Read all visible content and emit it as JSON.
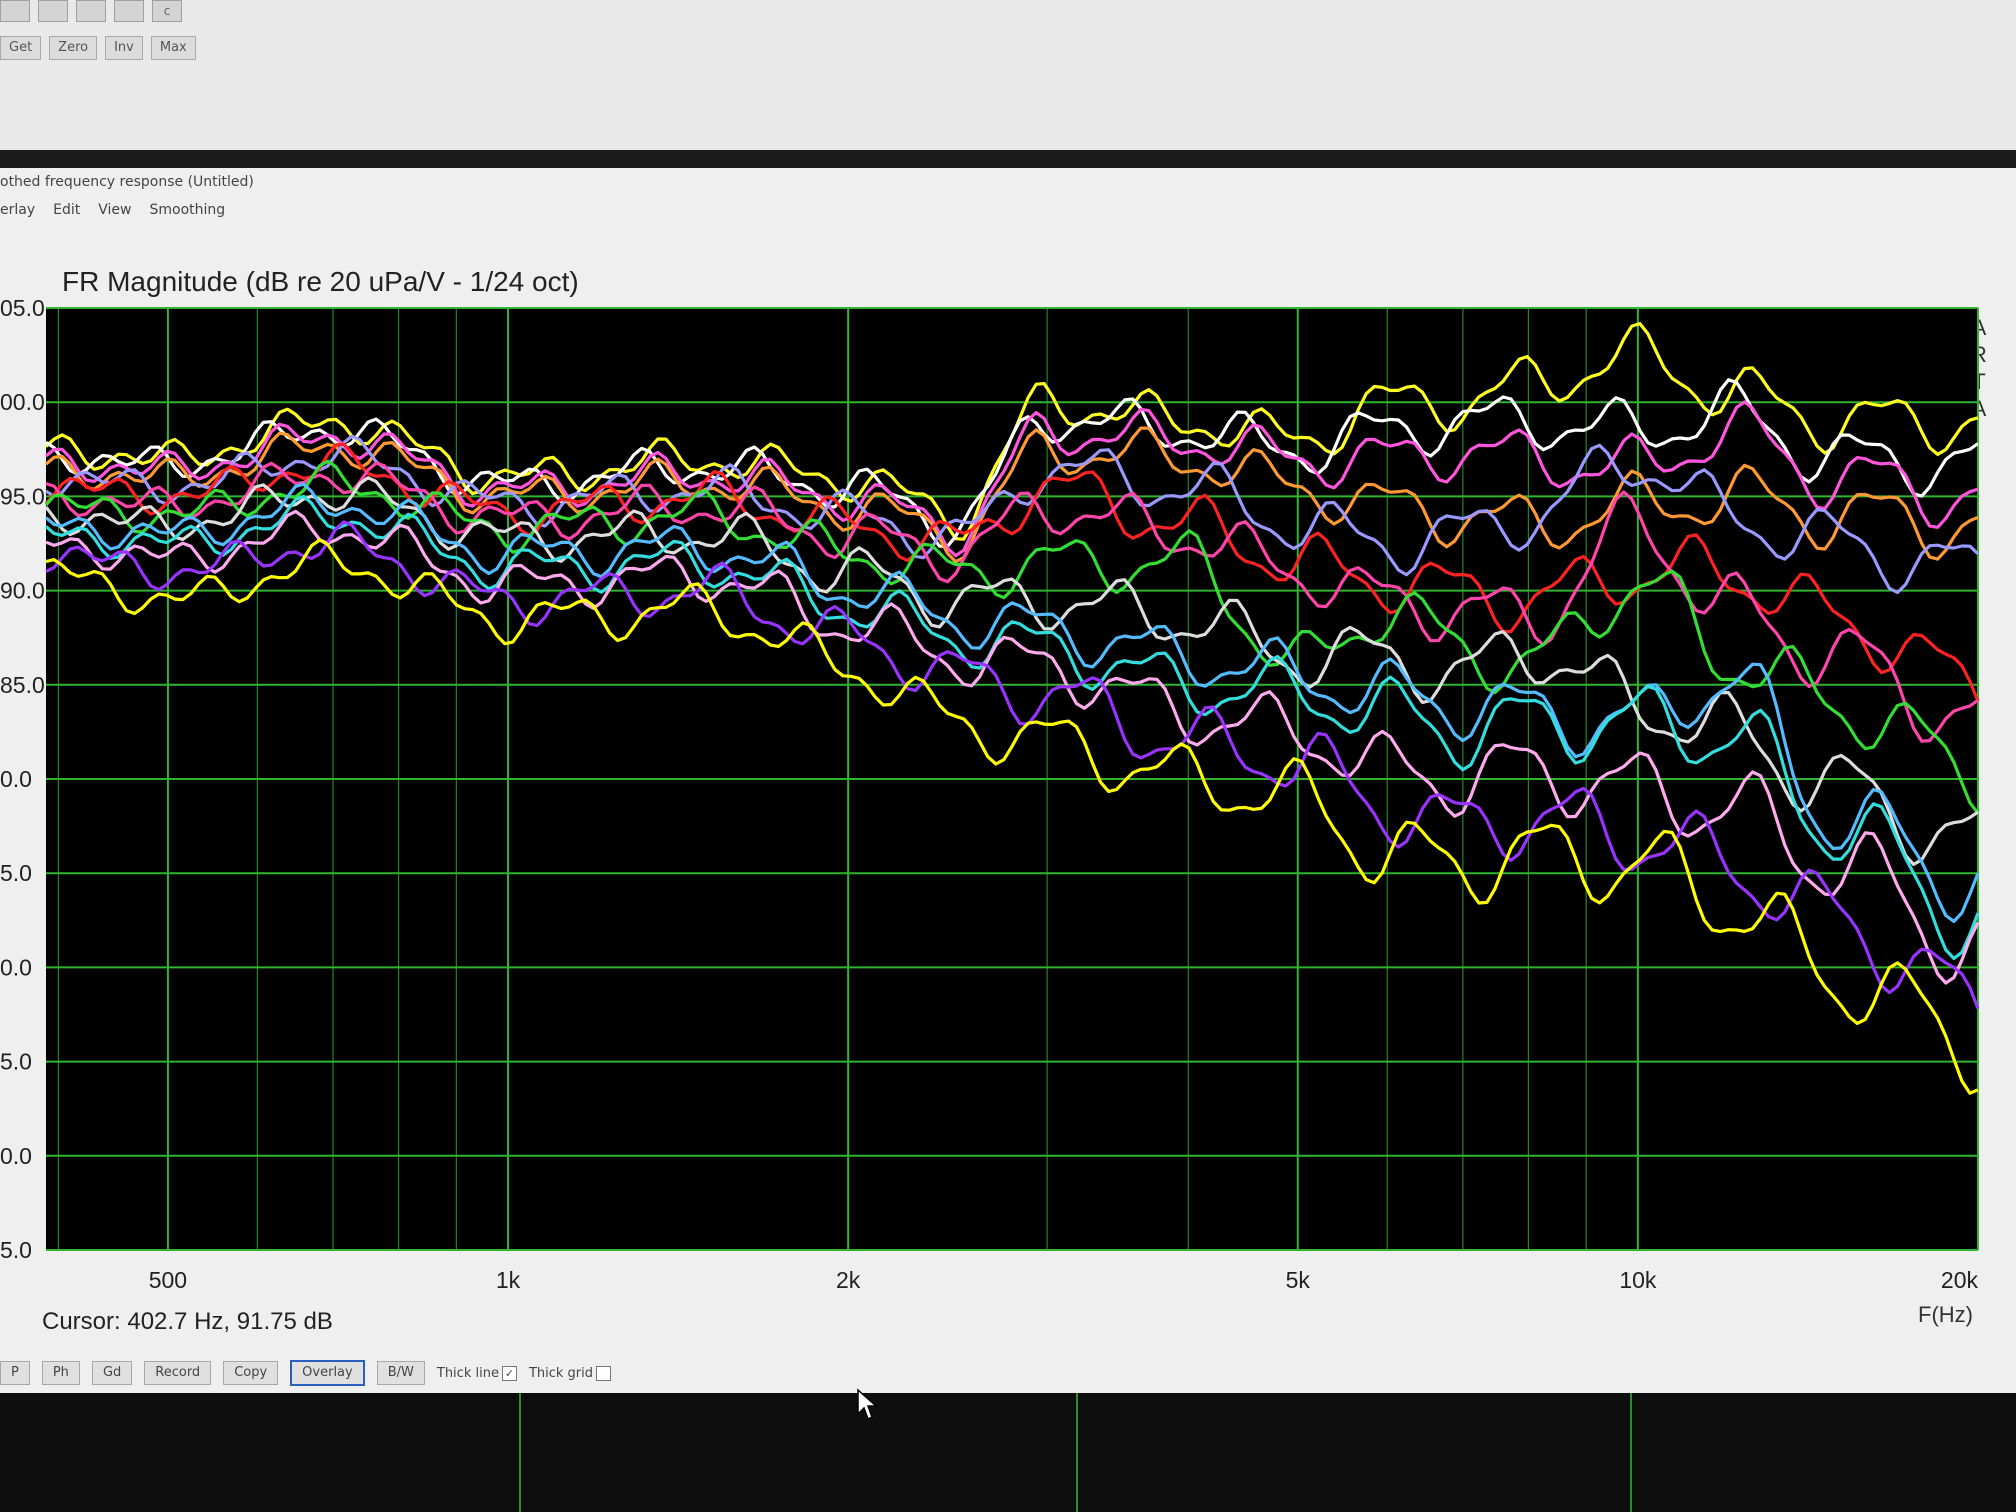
{
  "toolbar": {
    "icons": [
      "spectrum-icon",
      "window-icon",
      "overlay-icon",
      "graph-icon",
      "c-icon"
    ],
    "icon_glyphs": [
      "",
      "",
      "",
      "",
      "c"
    ],
    "buttons": [
      "Get",
      "Zero",
      "Inv",
      "Max"
    ]
  },
  "window": {
    "title": "othed frequency response (Untitled)",
    "menu": [
      "erlay",
      "Edit",
      "View",
      "Smoothing"
    ]
  },
  "footer": {
    "cursor": "Cursor: 402.7 Hz, 91.75 dB",
    "funit": "F(Hz)",
    "buttons": [
      "P",
      "Ph",
      "Gd",
      "Record",
      "Copy",
      "Overlay",
      "B/W"
    ],
    "active_button": "Overlay",
    "thick_line": "Thick line",
    "thick_line_checked": true,
    "thick_grid": "Thick grid",
    "thick_grid_checked": false,
    "brand": "ARTA"
  },
  "chart_data": {
    "type": "line",
    "title": "FR Magnitude (dB re 20 uPa/V - 1/24 oct)",
    "xlabel": "F(Hz)",
    "ylabel": "",
    "xscale": "log",
    "xlim": [
      390,
      20000
    ],
    "ylim": [
      55,
      105
    ],
    "yticks": [
      105,
      100,
      95,
      90,
      85,
      80,
      75,
      70,
      65,
      60,
      55
    ],
    "ytick_labels": [
      "05.0",
      "00.0",
      "95.0",
      "90.0",
      "85.0",
      "0.0",
      "5.0",
      "0.0",
      "5.0",
      "0.0",
      "5.0"
    ],
    "xticks": [
      500,
      1000,
      2000,
      5000,
      10000,
      20000
    ],
    "xtick_labels": [
      "500",
      "1k",
      "2k",
      "5k",
      "10k",
      "20k"
    ],
    "minor_grid_x": [
      400,
      600,
      700,
      800,
      900,
      3000,
      4000,
      6000,
      7000,
      8000,
      9000
    ],
    "grid": true,
    "background": "#000000",
    "grid_color": "#2fb52f",
    "x": [
      390,
      500,
      700,
      1000,
      1500,
      2000,
      2500,
      3000,
      4000,
      5000,
      6000,
      7000,
      8000,
      10000,
      12000,
      15000,
      20000
    ],
    "series": [
      {
        "color": "#ffff22",
        "values": [
          97.5,
          97,
          99,
          96,
          97,
          96,
          94,
          100,
          99,
          98,
          100,
          100,
          101,
          102.5,
          100.5,
          99,
          99
        ]
      },
      {
        "color": "#ffffff",
        "values": [
          97.2,
          96.7,
          98.6,
          95.6,
          96.6,
          95.5,
          93.6,
          99.2,
          98.5,
          97.5,
          98.5,
          99,
          99,
          98.5,
          99.5,
          97,
          96.8
        ]
      },
      {
        "color": "#ff55dd",
        "values": [
          96.8,
          96.4,
          98.2,
          95.3,
          96.2,
          95,
          93.3,
          98.5,
          98,
          97,
          97,
          97.5,
          97,
          96.5,
          98.5,
          96,
          95
        ]
      },
      {
        "color": "#ff9933",
        "values": [
          96.4,
          96,
          97.7,
          95,
          95.8,
          94.5,
          93,
          97.5,
          97,
          95.5,
          94.5,
          94,
          93.5,
          94.5,
          95,
          94,
          93.5
        ]
      },
      {
        "color": "#9999ff",
        "values": [
          96,
          95.5,
          97.2,
          94.6,
          95.4,
          94,
          92.8,
          96.5,
          95.5,
          93.5,
          92.5,
          93,
          94,
          97,
          94,
          92.5,
          91
        ]
      },
      {
        "color": "#ff2222",
        "values": [
          95.5,
          95,
          96.7,
          94.2,
          95,
          93.5,
          92.5,
          95.5,
          93.5,
          91.5,
          90.5,
          90,
          89.5,
          91,
          91,
          88.5,
          85
        ]
      },
      {
        "color": "#ff44aa",
        "values": [
          95,
          94.5,
          96.2,
          93.8,
          94.5,
          93,
          92,
          94.5,
          93,
          91,
          89.5,
          89,
          88.5,
          93.5,
          89,
          86.5,
          83
        ]
      },
      {
        "color": "#33dd33",
        "values": [
          94.5,
          94,
          95.7,
          93.3,
          94,
          92,
          91,
          91.5,
          91.5,
          86,
          89,
          87,
          86,
          90.5,
          86.5,
          84,
          80.5
        ]
      },
      {
        "color": "#dddddd",
        "values": [
          94,
          93.5,
          95.2,
          92.8,
          93,
          91,
          89.5,
          89.5,
          88.5,
          86.5,
          86.5,
          85.5,
          87,
          84,
          82.5,
          79.5,
          76.5
        ]
      },
      {
        "color": "#55bbff",
        "values": [
          93.5,
          93,
          94.7,
          92,
          92.3,
          90.2,
          88.5,
          88,
          86.5,
          85.5,
          84.5,
          84,
          83.5,
          83,
          85.5,
          78,
          74.5
        ]
      },
      {
        "color": "#33dddd",
        "values": [
          93,
          92.5,
          94,
          91.2,
          91.5,
          89.2,
          87.5,
          87,
          85,
          84.5,
          83.5,
          82.5,
          83,
          83,
          82.5,
          77.5,
          72.5
        ]
      },
      {
        "color": "#ffaaee",
        "values": [
          92.5,
          91.7,
          93.3,
          90.3,
          90.8,
          88.3,
          86.5,
          86,
          83.5,
          82.5,
          80.5,
          80,
          80.5,
          79.5,
          78.5,
          75.5,
          71
        ]
      },
      {
        "color": "#9933ff",
        "values": [
          92,
          91,
          92.5,
          89.5,
          90,
          87.5,
          85.5,
          84.5,
          82,
          81,
          78.5,
          77.5,
          78,
          77,
          75.5,
          72.5,
          68
        ]
      },
      {
        "color": "#ffff00",
        "values": [
          91,
          89.5,
          91.5,
          88.5,
          89,
          86,
          83,
          82,
          80,
          79,
          76,
          75.5,
          76,
          75.5,
          73.5,
          69.5,
          66
        ]
      }
    ]
  }
}
